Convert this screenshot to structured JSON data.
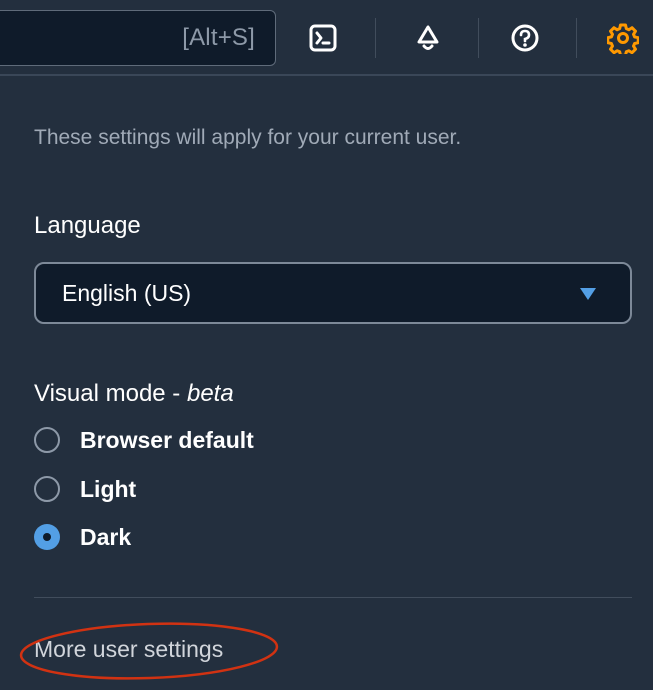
{
  "search": {
    "shortcut": "[Alt+S]"
  },
  "nav": {
    "icons": [
      "cloudshell-icon",
      "bell-icon",
      "help-icon",
      "gear-icon"
    ],
    "active_color": "#ff9900",
    "icon_color": "#ffffff"
  },
  "settings": {
    "description": "These settings will apply for your current user.",
    "language_label": "Language",
    "language_value": "English (US)",
    "visual_mode_label": "Visual mode - ",
    "visual_mode_suffix": "beta",
    "options": [
      {
        "label": "Browser default",
        "checked": false
      },
      {
        "label": "Light",
        "checked": false
      },
      {
        "label": "Dark",
        "checked": true
      }
    ],
    "more_link": "More user settings"
  },
  "colors": {
    "background": "#232f3e",
    "accent": "#539fe5",
    "annotation": "#d13212"
  }
}
